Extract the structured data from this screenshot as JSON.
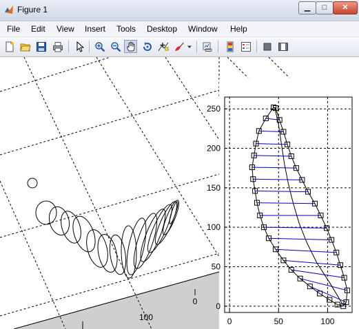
{
  "window": {
    "title": "Figure 1",
    "min_glyph": "▁",
    "max_glyph": "□",
    "close_glyph": "✕"
  },
  "menu": [
    "File",
    "Edit",
    "View",
    "Insert",
    "Tools",
    "Desktop",
    "Window",
    "Help"
  ],
  "toolbar": {
    "buttons": [
      "new-figure-icon",
      "open-file-icon",
      "save-icon",
      "print-icon",
      "edit-plot-arrow-icon",
      "zoom-in-icon",
      "zoom-out-icon",
      "pan-hand-icon",
      "rotate-3d-icon",
      "data-cursor-icon",
      "brush-icon",
      "dropdown-arrow-icon",
      "link-plot-icon",
      "insert-colorbar-icon",
      "insert-legend-icon",
      "hide-plot-tools-icon",
      "show-plot-tools-icon"
    ],
    "pressed": "pan-hand-icon"
  },
  "left_axes": {
    "tick_labels": [
      "0",
      "100"
    ]
  },
  "chart_data": {
    "type": "line",
    "x_ticks": [
      "0",
      "50",
      "100"
    ],
    "y_ticks": [
      "0",
      "50",
      "100",
      "150",
      "200",
      "250"
    ],
    "xlim": [
      -5,
      125
    ],
    "ylim": [
      -8,
      265
    ],
    "grid": true,
    "colors": {
      "outline": "#000000",
      "spokes": "#0000cc",
      "grid": "#000000"
    },
    "outline_points": [
      [
        45,
        252
      ],
      [
        37,
        238
      ],
      [
        30,
        222
      ],
      [
        27,
        206
      ],
      [
        25,
        191
      ],
      [
        23,
        176
      ],
      [
        24,
        161
      ],
      [
        26,
        146
      ],
      [
        28,
        131
      ],
      [
        31,
        115
      ],
      [
        35,
        100
      ],
      [
        40,
        86
      ],
      [
        47,
        72
      ],
      [
        55,
        58
      ],
      [
        63,
        46
      ],
      [
        72,
        35
      ],
      [
        82,
        25
      ],
      [
        92,
        16
      ],
      [
        102,
        8
      ],
      [
        110,
        2
      ],
      [
        116,
        0
      ],
      [
        119,
        5
      ],
      [
        120,
        20
      ],
      [
        117,
        36
      ],
      [
        113,
        52
      ],
      [
        109,
        68
      ],
      [
        104,
        84
      ],
      [
        99,
        99
      ],
      [
        93,
        115
      ],
      [
        87,
        130
      ],
      [
        80,
        145
      ],
      [
        74,
        160
      ],
      [
        68,
        175
      ],
      [
        63,
        190
      ],
      [
        59,
        205
      ],
      [
        55,
        221
      ],
      [
        51,
        236
      ],
      [
        47,
        251
      ]
    ],
    "spokes": [
      [
        [
          37,
          238
        ],
        [
          51,
          236
        ]
      ],
      [
        [
          30,
          222
        ],
        [
          55,
          221
        ]
      ],
      [
        [
          27,
          206
        ],
        [
          59,
          205
        ]
      ],
      [
        [
          25,
          191
        ],
        [
          63,
          190
        ]
      ],
      [
        [
          23,
          176
        ],
        [
          68,
          175
        ]
      ],
      [
        [
          24,
          161
        ],
        [
          74,
          160
        ]
      ],
      [
        [
          26,
          146
        ],
        [
          80,
          145
        ]
      ],
      [
        [
          28,
          131
        ],
        [
          87,
          130
        ]
      ],
      [
        [
          31,
          115
        ],
        [
          93,
          115
        ]
      ],
      [
        [
          35,
          100
        ],
        [
          99,
          99
        ]
      ],
      [
        [
          40,
          86
        ],
        [
          104,
          84
        ]
      ],
      [
        [
          47,
          72
        ],
        [
          109,
          68
        ]
      ],
      [
        [
          55,
          58
        ],
        [
          113,
          52
        ]
      ],
      [
        [
          63,
          46
        ],
        [
          117,
          36
        ]
      ],
      [
        [
          72,
          35
        ],
        [
          120,
          20
        ]
      ],
      [
        [
          82,
          25
        ],
        [
          119,
          5
        ]
      ]
    ],
    "centerline": [
      [
        46,
        252
      ],
      [
        50,
        230
      ],
      [
        53,
        205
      ],
      [
        56,
        180
      ],
      [
        60,
        155
      ],
      [
        65,
        130
      ],
      [
        71,
        105
      ],
      [
        79,
        80
      ],
      [
        89,
        55
      ],
      [
        102,
        30
      ],
      [
        116,
        1
      ]
    ]
  }
}
